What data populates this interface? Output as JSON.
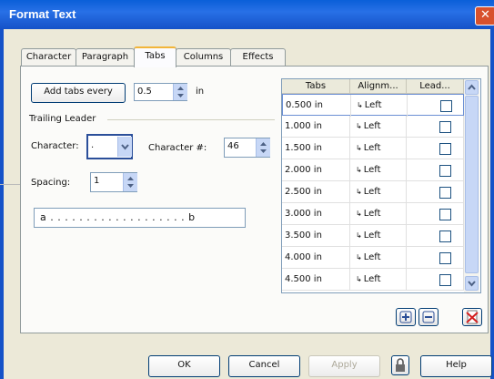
{
  "window": {
    "title": "Format Text",
    "close_glyph": "✕"
  },
  "tabs": [
    {
      "label": "Character"
    },
    {
      "label": "Paragraph"
    },
    {
      "label": "Tabs"
    },
    {
      "label": "Columns"
    },
    {
      "label": "Effects"
    }
  ],
  "add_tabs": {
    "button_label": "Add tabs every",
    "value": "0.5",
    "unit": "in"
  },
  "trailing_leader": {
    "section_label": "Trailing Leader",
    "character_label": "Character:",
    "character_value": ".",
    "character_number_label": "Character #:",
    "character_number_value": "46",
    "spacing_label": "Spacing:",
    "spacing_value": "1",
    "preview_text": "a . . . . . . . . . . . . . . . . . . . b"
  },
  "tab_grid": {
    "headers": [
      "Tabs",
      "Alignm...",
      "Lead..."
    ],
    "rows": [
      {
        "tab": "0.500 in",
        "alignment": "Left",
        "leader": false
      },
      {
        "tab": "1.000 in",
        "alignment": "Left",
        "leader": false
      },
      {
        "tab": "1.500 in",
        "alignment": "Left",
        "leader": false
      },
      {
        "tab": "2.000 in",
        "alignment": "Left",
        "leader": false
      },
      {
        "tab": "2.500 in",
        "alignment": "Left",
        "leader": false
      },
      {
        "tab": "3.000 in",
        "alignment": "Left",
        "leader": false
      },
      {
        "tab": "3.500 in",
        "alignment": "Left",
        "leader": false
      },
      {
        "tab": "4.000 in",
        "alignment": "Left",
        "leader": false
      },
      {
        "tab": "4.500 in",
        "alignment": "Left",
        "leader": false
      }
    ],
    "align_glyph": "↳"
  },
  "footer": {
    "ok": "OK",
    "cancel": "Cancel",
    "apply": "Apply",
    "help": "Help"
  },
  "colors": {
    "titlebar": "#1552c8",
    "dialog_bg": "#ece9d8",
    "active_tab_highlight": "#f2b53a"
  }
}
